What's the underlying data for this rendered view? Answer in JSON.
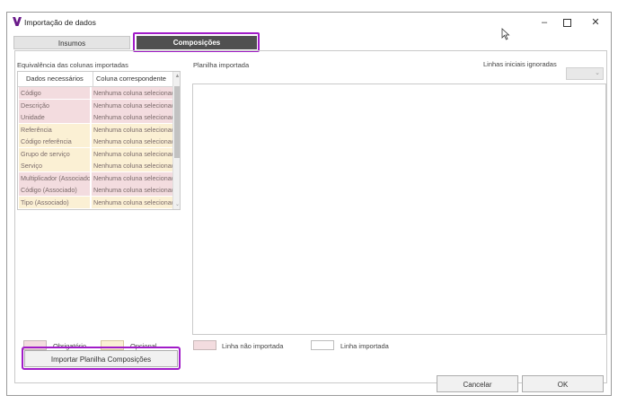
{
  "window": {
    "title": "Importação de dados"
  },
  "tabs": [
    {
      "label": "Insumos"
    },
    {
      "label": "Composições"
    }
  ],
  "mapping": {
    "section_label": "Equivalência das colunas importadas",
    "headers": [
      "Dados necessários",
      "Coluna correspondente"
    ],
    "rows": [
      {
        "field": "Código",
        "value": "Nenhuma coluna selecionada",
        "kind": "required"
      },
      {
        "field": "Descrição",
        "value": "Nenhuma coluna selecionada",
        "kind": "required"
      },
      {
        "field": "Unidade",
        "value": "Nenhuma coluna selecionada",
        "kind": "required"
      },
      {
        "field": "Referência",
        "value": "Nenhuma coluna selecionada",
        "kind": "optional"
      },
      {
        "field": "Código referência",
        "value": "Nenhuma coluna selecionada",
        "kind": "optional"
      },
      {
        "field": "Grupo de serviço",
        "value": "Nenhuma coluna selecionada",
        "kind": "optional"
      },
      {
        "field": "Serviço",
        "value": "Nenhuma coluna selecionada",
        "kind": "optional"
      },
      {
        "field": "Multiplicador (Associado)",
        "value": "Nenhuma coluna selecionada",
        "kind": "required"
      },
      {
        "field": "Código (Associado)",
        "value": "Nenhuma coluna selecionada",
        "kind": "required"
      },
      {
        "field": "Tipo (Associado)",
        "value": "Nenhuma coluna selecionada",
        "kind": "optional"
      }
    ]
  },
  "sheet": {
    "section_label": "Planilha importada",
    "ignored_lines_label": "Linhas iniciais ignoradas",
    "ignored_lines_value": ""
  },
  "legend_left": {
    "required_label": "Obrigatório",
    "optional_label": "Opcional"
  },
  "legend_right": {
    "not_imported_label": "Linha não importada",
    "imported_label": "Linha importada"
  },
  "buttons": {
    "import_label": "Importar Planilha Composições",
    "cancel_label": "Cancelar",
    "ok_label": "OK"
  },
  "colors": {
    "required": "#f3dcdf",
    "optional": "#fbf0d4",
    "active_tab": "#505050",
    "highlight": "#a11cc8",
    "logo": "#6a1b8a"
  },
  "icons": [
    "app-logo-icon",
    "minimize-icon",
    "maximize-icon",
    "close-icon",
    "dropdown-arrow-icon",
    "mouse-cursor-icon"
  ]
}
